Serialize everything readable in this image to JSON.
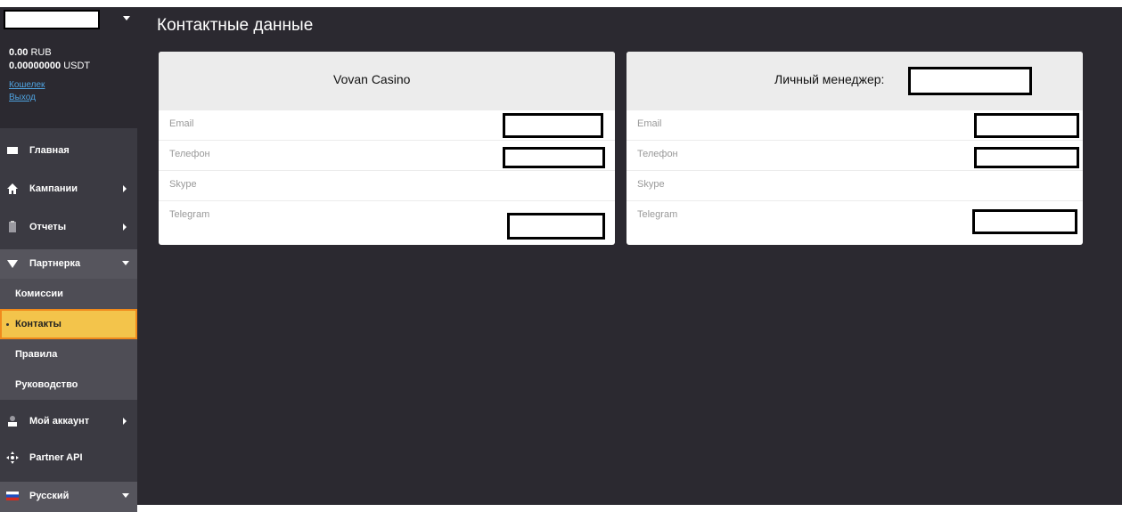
{
  "sidebar": {
    "balance_rub_value": "0.00",
    "balance_rub_unit": "RUB",
    "balance_usdt_value": "0.00000000",
    "balance_usdt_unit": "USDT",
    "wallet_link": "Кошелек",
    "logout_link": "Выход",
    "nav": {
      "home": "Главная",
      "campaigns": "Кампании",
      "reports": "Отчеты",
      "partner": "Партнерка",
      "my_account": "Мой аккаунт",
      "partner_api": "Partner API",
      "language": "Русский"
    },
    "partner_sub": [
      "Комиссии",
      "Контакты",
      "Правила",
      "Руководство"
    ]
  },
  "main": {
    "title": "Контактные данные",
    "cards": [
      {
        "title": "Vovan Casino",
        "rows": [
          "Email",
          "Телефон",
          "Skype",
          "Telegram"
        ]
      },
      {
        "title": "Личный менеджер:",
        "rows": [
          "Email",
          "Телефон",
          "Skype",
          "Telegram"
        ]
      }
    ]
  },
  "colors": {
    "background": "#2b2930",
    "sidebar": "#3b3a42",
    "highlight": "#f3c44b",
    "highlight_border": "#f08a1c",
    "link": "#4fa3e0"
  }
}
